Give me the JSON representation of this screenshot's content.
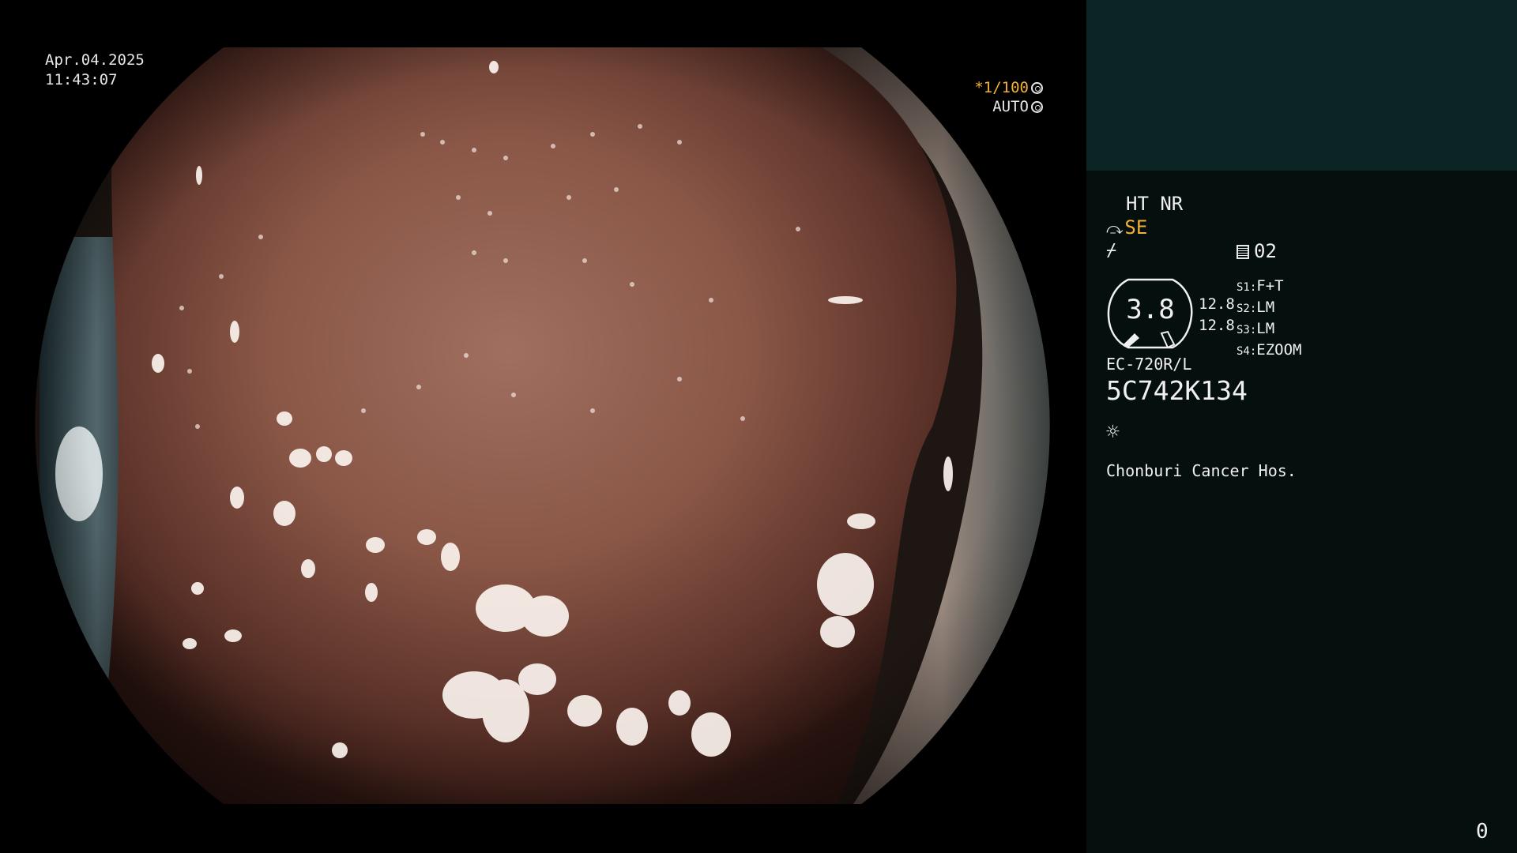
{
  "overlay": {
    "date": "Apr.04.2025",
    "time": "11:43:07",
    "shutter_ratio": "*1/100",
    "exposure_mode": "AUTO"
  },
  "info_panel": {
    "image_processing": "HT NR",
    "structure_enhancement": "SE",
    "memory_label": "02",
    "zoom_value": "3.8",
    "enhancement_values": [
      "12.8",
      "12.8"
    ],
    "switches": [
      {
        "key": "S1:",
        "value": "F+T"
      },
      {
        "key": "S2:",
        "value": "LM"
      },
      {
        "key": "S3:",
        "value": "LM"
      },
      {
        "key": "S4:",
        "value": "EZOOM"
      }
    ],
    "scope_model": "EC-720R/L",
    "serial_number": "5C742K134",
    "institution": "Chonburi Cancer Hos.",
    "frame_counter": "0"
  },
  "icons": {
    "structure_enhance": "se-icon",
    "filter": "filter-icon",
    "memory": "memory-icon",
    "light_source": "light-icon",
    "shutter": "shutter-icon",
    "exposure": "exposure-icon"
  },
  "colors": {
    "panel_bg": "#040f0e",
    "panel_top_bg": "#0d2425",
    "highlight": "#f2b233",
    "tissue": "#8a5747"
  }
}
